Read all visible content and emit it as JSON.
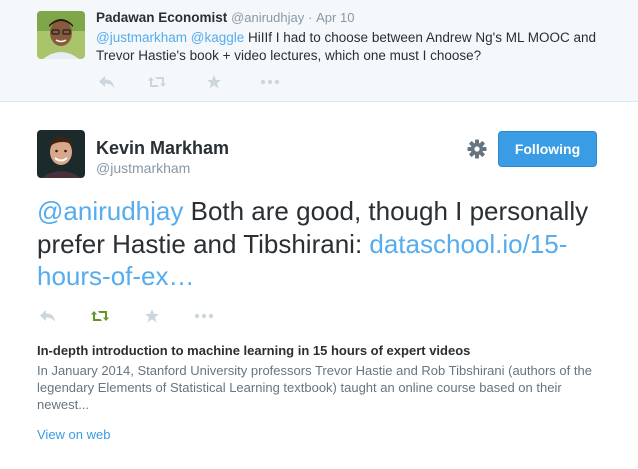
{
  "parent_tweet": {
    "author_name": "Padawan Economist",
    "author_handle": "@anirudhjay",
    "separator": "·",
    "date": "Apr 10",
    "text_mention_1": "@justmarkham",
    "text_mention_2": "@kaggle",
    "text_body": " HiIIf I had to choose between Andrew Ng's ML MOOC and Trevor Hastie's book + video lectures, which one must I choose?",
    "actions": [
      "reply-icon",
      "retweet-icon",
      "favorite-icon",
      "more-icon"
    ]
  },
  "main_tweet": {
    "author_name": "Kevin Markham",
    "author_handle": "@justmarkham",
    "settings_icon": "gear-icon",
    "follow_button_label": "Following",
    "text_mention": "@anirudhjay",
    "text_body": " Both are good, though I personally prefer Hastie and Tibshirani: ",
    "text_link": "dataschool.io/15-hours-of-ex…",
    "actions": [
      "reply-icon",
      "retweet-icon",
      "favorite-icon",
      "more-icon"
    ],
    "retweeted": true
  },
  "card": {
    "title": "In-depth introduction to machine learning in 15 hours of expert videos",
    "description": "In January 2014, Stanford University professors Trevor Hastie and Rob Tibshirani (authors of the legendary Elements of Statistical Learning textbook) taught an online course based on their newest...",
    "view_link": "View on web"
  },
  "colors": {
    "link": "#55acee",
    "button": "#3a9ce4",
    "muted": "#8899a6",
    "retweet_active": "#609928",
    "icon_muted": "#ccd6dd"
  }
}
